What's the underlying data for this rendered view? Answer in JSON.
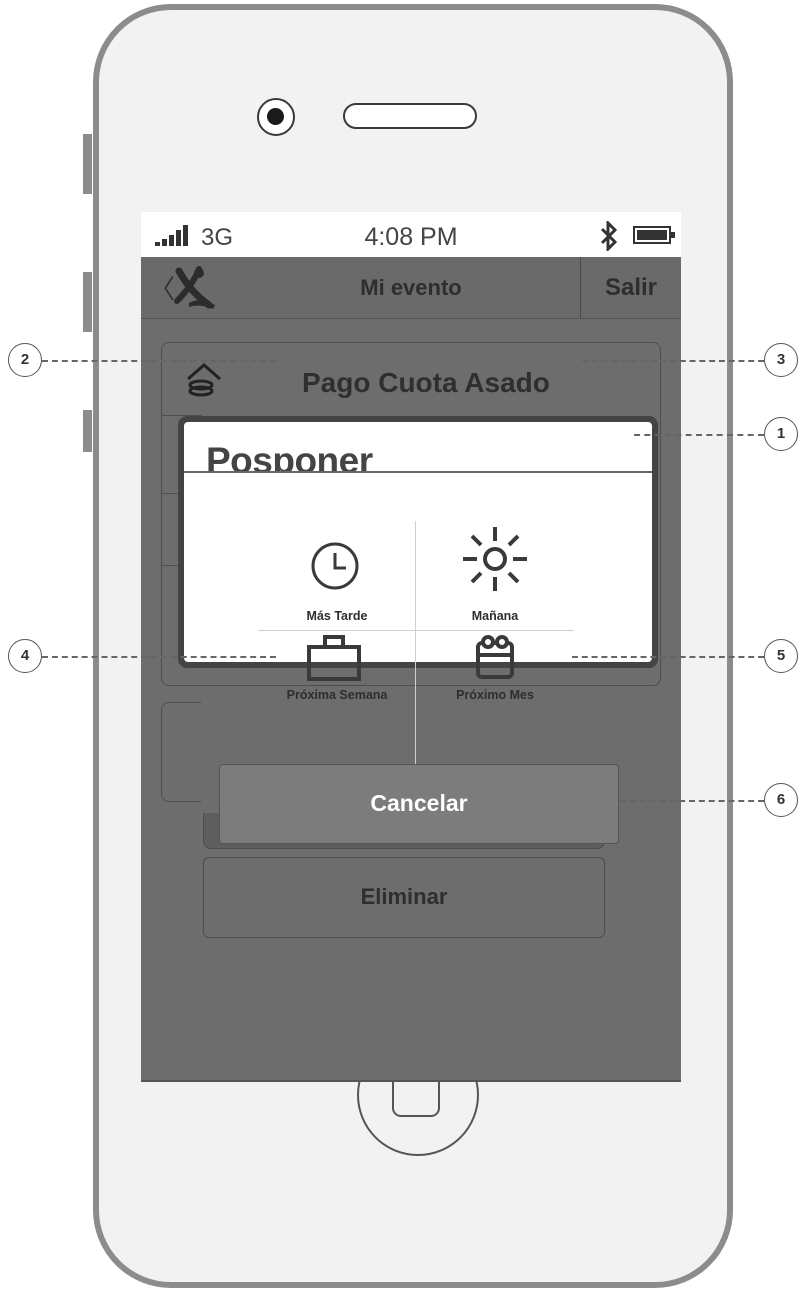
{
  "status_bar": {
    "network": "3G",
    "time": "4:08 PM"
  },
  "nav": {
    "title": "Mi evento",
    "exit_label": "Salir",
    "back_icon": "chevron-left-icon",
    "logo_icon": "app-logo-icon"
  },
  "card": {
    "title": "Pago Cuota Asado",
    "icon": "payment-hand-coins-icon"
  },
  "background_actions": {
    "delete_label": "Eliminar"
  },
  "postpone_dialog": {
    "title": "Posponer",
    "options": [
      {
        "label": "Más Tarde",
        "icon": "clock-icon"
      },
      {
        "label": "Mañana",
        "icon": "sun-icon"
      },
      {
        "label": "Próxima Semana",
        "icon": "briefcase-icon"
      },
      {
        "label": "Próximo Mes",
        "icon": "calendar-icon"
      }
    ],
    "cancel_label": "Cancelar"
  },
  "callouts": [
    "1",
    "2",
    "3",
    "4",
    "5",
    "6"
  ],
  "colors": {
    "screen_dim": "#6d6d6d",
    "dialog_bg": "#ffffff",
    "cancel_button": "#7c7c7c",
    "frame": "#8c8c8c"
  }
}
